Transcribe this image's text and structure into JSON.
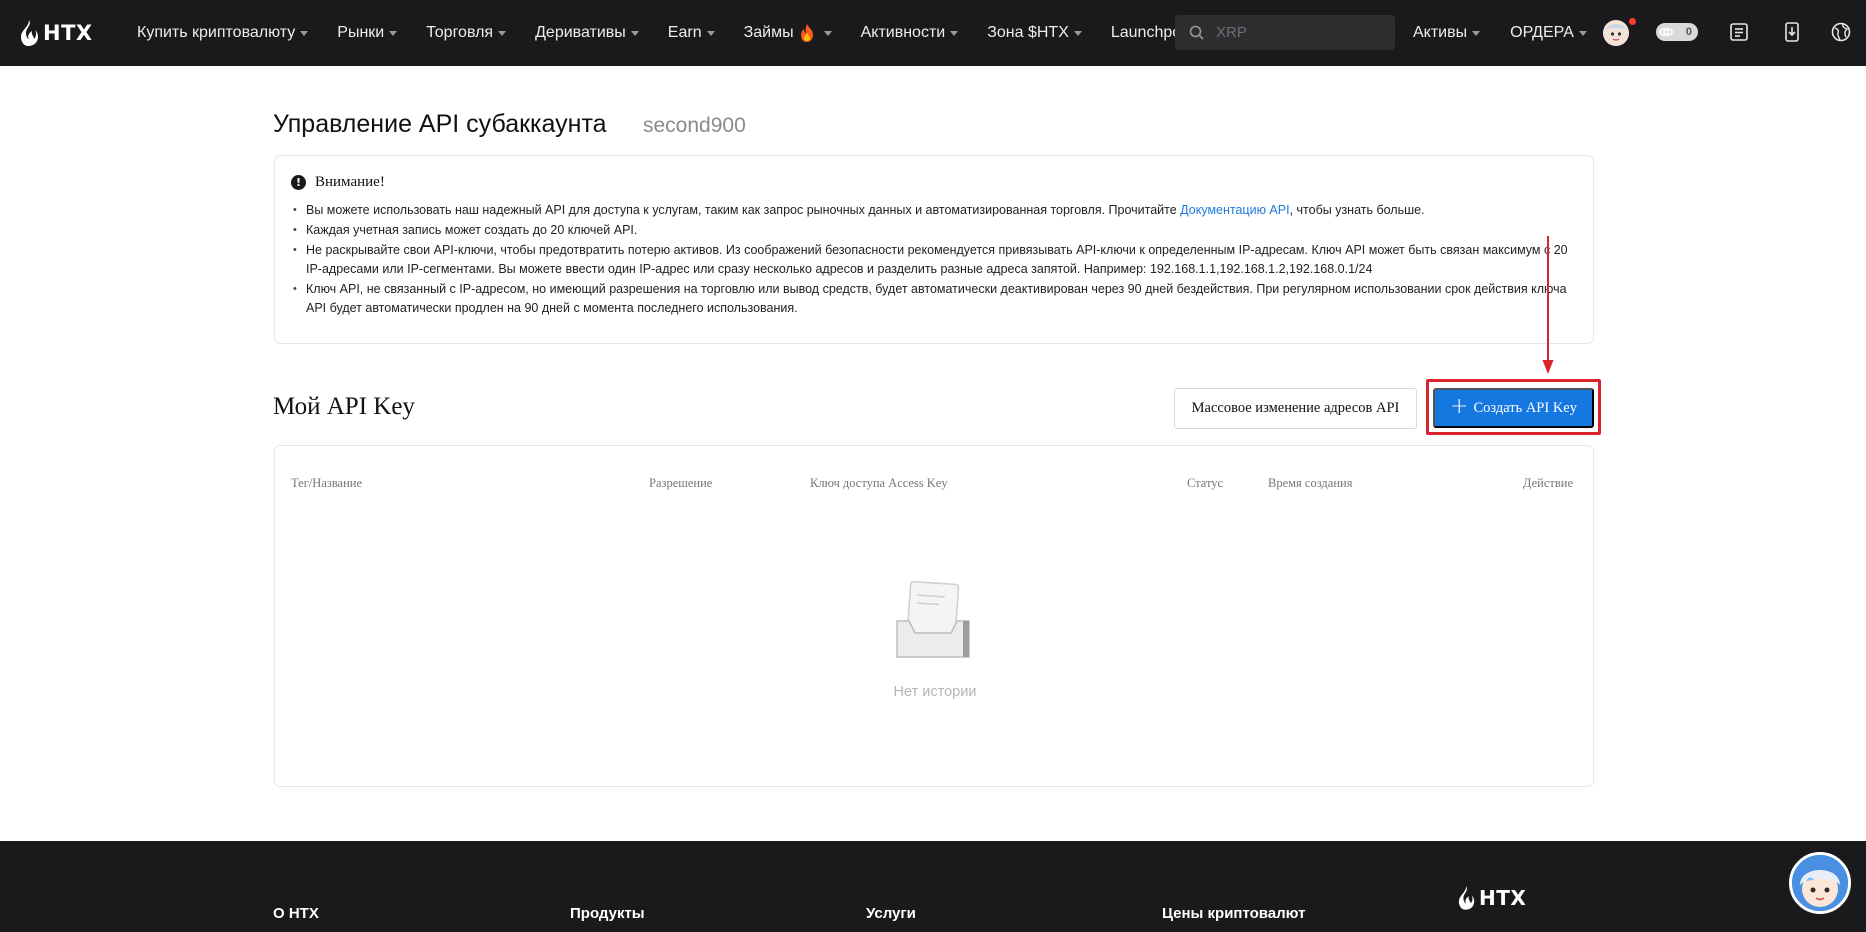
{
  "brand": {
    "name": "HTX"
  },
  "nav": {
    "items": [
      {
        "label": "Купить криптовалюту",
        "caret": true
      },
      {
        "label": "Рынки",
        "caret": true
      },
      {
        "label": "Торговля",
        "caret": true
      },
      {
        "label": "Деривативы",
        "caret": true
      },
      {
        "label": "Earn",
        "caret": true
      },
      {
        "label": "Займы",
        "caret": true
      },
      {
        "label": "Активности",
        "caret": true
      },
      {
        "label": "Зона $HTX",
        "caret": true
      },
      {
        "label": "Launchpool",
        "caret": false
      }
    ],
    "search_placeholder": "XRP",
    "right_items": [
      {
        "label": "Активы"
      },
      {
        "label": "ОРДЕРА"
      }
    ],
    "toggle_value": "0"
  },
  "page": {
    "title": "Управление API субаккаунта",
    "subaccount": "second900"
  },
  "notice": {
    "heading": "Внимание!",
    "items": [
      {
        "text_before": "Вы можете использовать наш надежный API для доступа к услугам, таким как запрос рыночных данных и автоматизированная торговля. Прочитайте ",
        "link": "Документацию API",
        "text_after": ", чтобы узнать больше."
      },
      {
        "text": "Каждая учетная запись может создать до 20 ключей API."
      },
      {
        "text": "Не раскрывайте свои API-ключи, чтобы предотвратить потерю активов. Из соображений безопасности рекомендуется привязывать API-ключи к определенным IP-адресам. Ключ API может быть связан максимум с 20 IP-адресами или IP-сегментами. Вы можете ввести один IP-адрес или сразу несколько адресов и разделить разные адреса запятой. Например: 192.168.1.1,192.168.1.2,192.168.0.1/24"
      },
      {
        "text": "Ключ API, не связанный с IP-адресом, но имеющий разрешения на торговлю или вывод средств, будет автоматически деактивирован через 90 дней бездействия. При регулярном использовании срок действия ключа API будет автоматически продлен на 90 дней с момента последнего использования."
      }
    ]
  },
  "api_section": {
    "title": "Мой API Key",
    "bulk_button": "Массовое изменение адресов API",
    "create_button": "Создать API Key",
    "columns": [
      "Тег/Название",
      "Разрешение",
      "Ключ доступа Access Key",
      "Статус",
      "Время создания",
      "Действие"
    ],
    "empty_text": "Нет истории"
  },
  "footer": {
    "columns": [
      "О HTX",
      "Продукты",
      "Услуги",
      "Цены криптовалют"
    ],
    "brand": "HTX"
  },
  "colors": {
    "nav_bg": "#1a1a1c",
    "accent_blue": "#1478e0",
    "highlight_red": "#d8242c"
  }
}
